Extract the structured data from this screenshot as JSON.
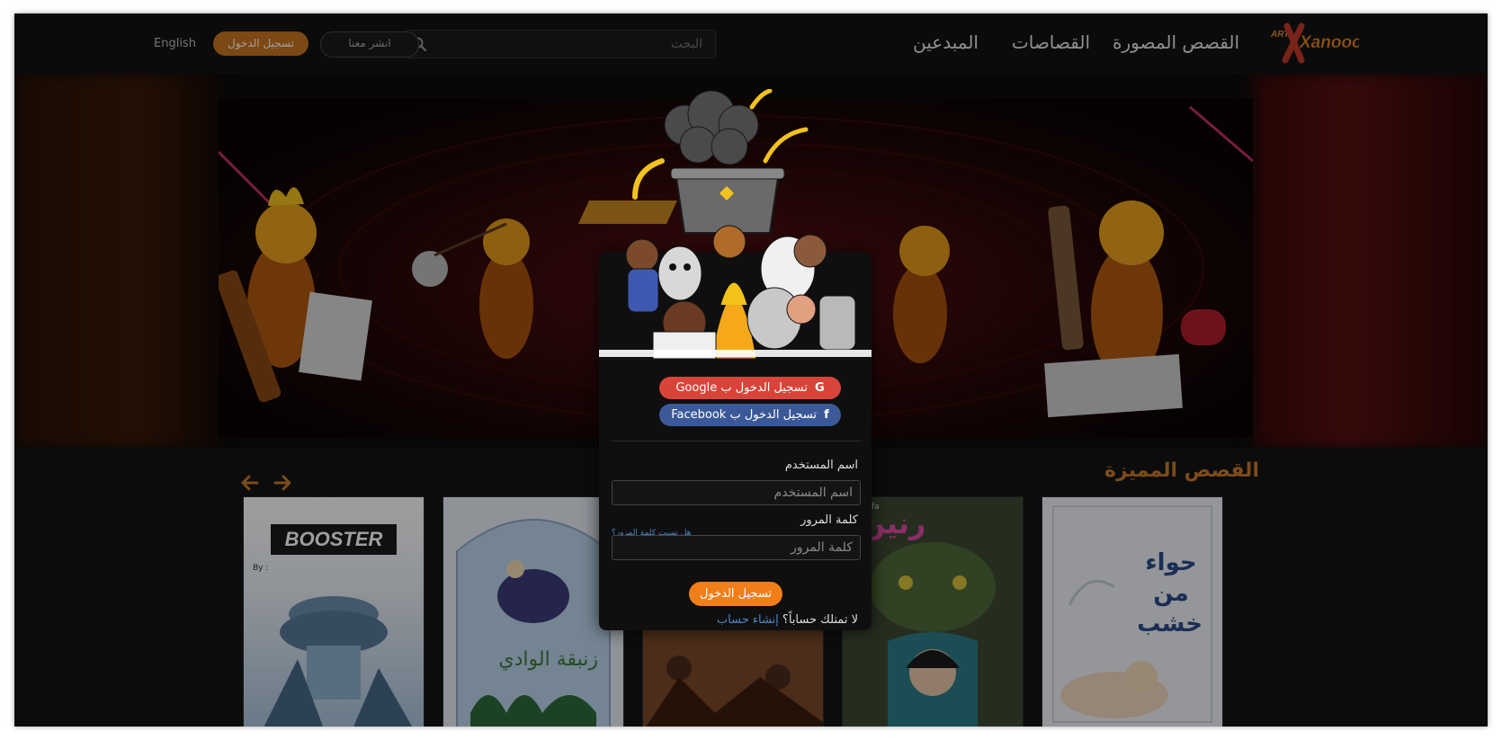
{
  "brand": {
    "logo_top": "ART",
    "logo_main": "Xanooo"
  },
  "nav": {
    "comics": "القصص المصورة",
    "storytellers": "القصاصات",
    "creators": "المبدعين",
    "search_placeholder": "البحث",
    "publish_with_us": "انشر معنا",
    "login": "تسجيل الدخول",
    "language": "English"
  },
  "featured": {
    "title": "القصص المميزة",
    "covers": [
      {
        "title": "BOOSTER",
        "subtitle": "By :"
      },
      {
        "title": "زنبقة الوادي"
      },
      {
        "title": ""
      },
      {
        "title": "رنين",
        "subtitle": "mostafa"
      },
      {
        "title": "حواء من خشب"
      }
    ]
  },
  "login_modal": {
    "google_label": "تسجيل الدخول ب Google",
    "facebook_label": "تسجيل الدخول ب Facebook",
    "username_label": "اسم المستخدم",
    "username_placeholder": "اسم المستخدم",
    "password_label": "كلمة المرور",
    "password_placeholder": "كلمة المرور",
    "forgot_password": "هل نسيت كلمة المرور؟",
    "submit_label": "تسجيل الدخول",
    "no_account_text": "لا تمتلك حساباً؟",
    "create_account": "إنشاء حساب"
  },
  "colors": {
    "accent": "#f07f1a",
    "title_orange": "#c9792a",
    "google_red": "#d9443a",
    "facebook_blue": "#3b5998",
    "link_blue": "#4c86c6"
  }
}
